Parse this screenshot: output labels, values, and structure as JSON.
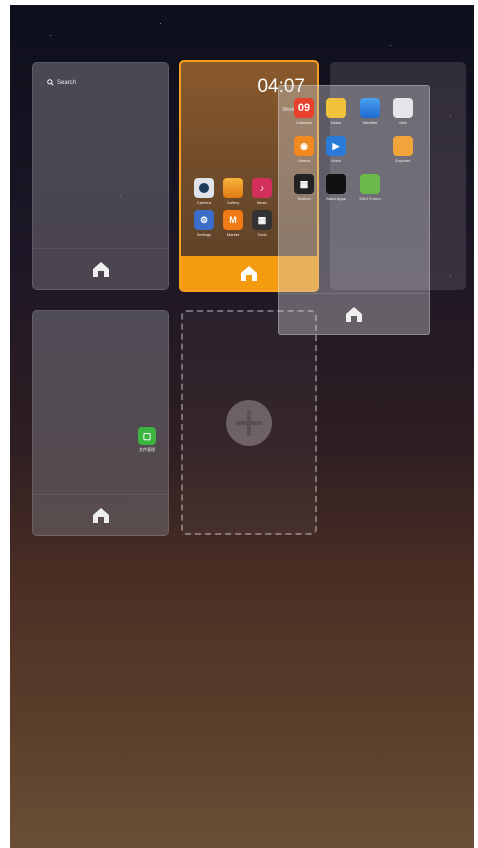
{
  "cards": {
    "card1": {
      "search_label": "Search"
    },
    "card2": {
      "clock": "04:07",
      "date_line1": "2013",
      "date_line2": "Wednes...",
      "apps": [
        {
          "label": "Camera",
          "icon": "camera-icon"
        },
        {
          "label": "Gallery",
          "icon": "gallery-icon"
        },
        {
          "label": "Music",
          "icon": "music-icon"
        },
        {
          "label": "Settings",
          "icon": "settings-icon"
        },
        {
          "label": "Market",
          "icon": "market-icon"
        },
        {
          "label": "Tools",
          "icon": "tools-icon"
        }
      ]
    },
    "card3": {
      "app_label": "文件管理"
    }
  },
  "overlay": {
    "apps": [
      {
        "label": "Calendar",
        "icon": "calendar-icon",
        "text": "09"
      },
      {
        "label": "Notes",
        "icon": "notes-icon"
      },
      {
        "label": "Weather",
        "icon": "weather-icon"
      },
      {
        "label": "Mail",
        "icon": "mail-icon"
      },
      {
        "label": "Games",
        "icon": "games-icon"
      },
      {
        "label": "Video",
        "icon": "video-icon"
      },
      {
        "label": "Explorer",
        "icon": "explorer-icon"
      },
      {
        "label": "Toolbox",
        "icon": "folder-icon"
      },
      {
        "label": "Black Apps",
        "icon": "black-app-icon"
      },
      {
        "label": "MIUI Forum",
        "icon": "android-icon"
      }
    ]
  },
  "colors": {
    "accent": "#f59b10",
    "active_border": "#f5a020"
  }
}
